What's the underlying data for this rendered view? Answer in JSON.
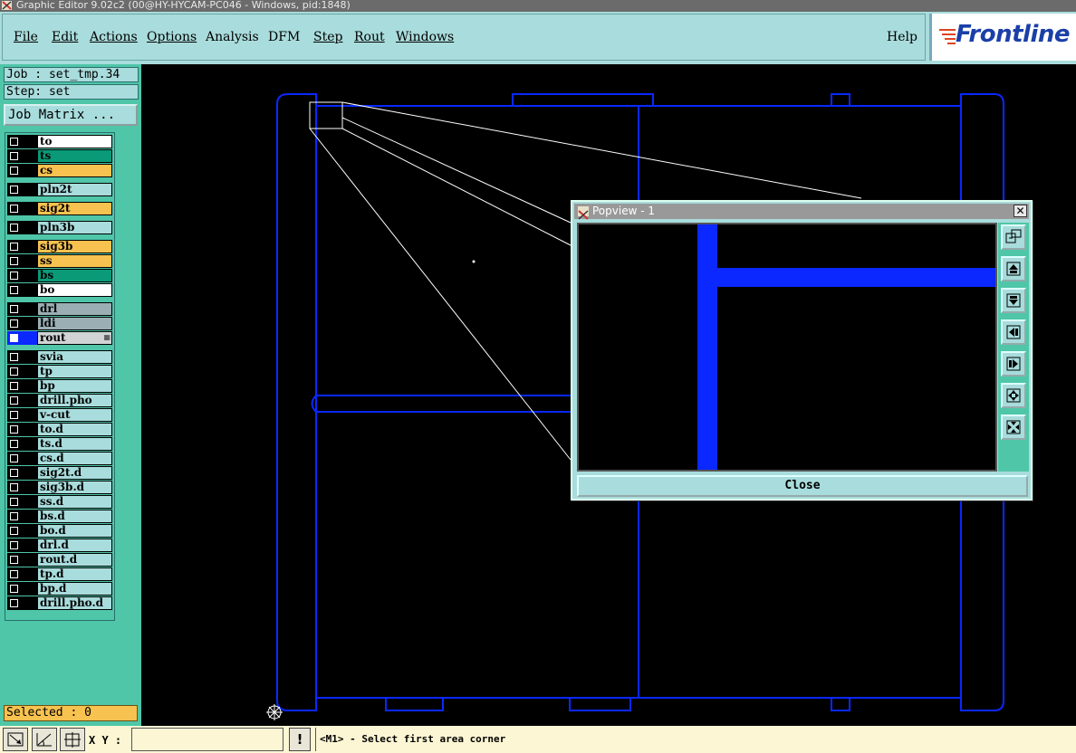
{
  "window": {
    "title": "Graphic Editor 9.02c2 (00@HY-HYCAM-PC046 - Windows, pid:1848)"
  },
  "menu": {
    "items": [
      {
        "label": "File"
      },
      {
        "label": "Edit"
      },
      {
        "label": "Actions"
      },
      {
        "label": "Options"
      },
      {
        "label": "Analysis"
      },
      {
        "label": "DFM"
      },
      {
        "label": "Step"
      },
      {
        "label": "Rout"
      },
      {
        "label": "Windows"
      }
    ],
    "help": "Help",
    "logo": "Frontline"
  },
  "job": {
    "job_label": "Job : set_tmp.34",
    "step_label": "Step: set",
    "job_matrix_button": "Job Matrix ..."
  },
  "layers": [
    {
      "name": "to",
      "color": "#ffffff",
      "active": false
    },
    {
      "name": "ts",
      "color": "#0a9a78",
      "active": false
    },
    {
      "name": "cs",
      "color": "#f7c24f",
      "active": false
    },
    {
      "name": "pln2t",
      "color": "#a9dcdc",
      "active": false
    },
    {
      "name": "sig2t",
      "color": "#f7c24f",
      "active": false
    },
    {
      "name": "pln3b",
      "color": "#a9dcdc",
      "active": false
    },
    {
      "name": "sig3b",
      "color": "#f7c24f",
      "active": false
    },
    {
      "name": "ss",
      "color": "#f7c24f",
      "active": false
    },
    {
      "name": "bs",
      "color": "#0a9a78",
      "active": false
    },
    {
      "name": "bo",
      "color": "#ffffff",
      "active": false
    },
    {
      "name": "drl",
      "color": "#9aaeb4",
      "active": false
    },
    {
      "name": "ldi",
      "color": "#9aaeb4",
      "active": false
    },
    {
      "name": "rout",
      "color": "#d0d4d4",
      "active": true
    },
    {
      "name": "svia",
      "color": "#a9dcdc",
      "active": false
    },
    {
      "name": "tp",
      "color": "#a9dcdc",
      "active": false
    },
    {
      "name": "bp",
      "color": "#a9dcdc",
      "active": false
    },
    {
      "name": "drill.pho",
      "color": "#a9dcdc",
      "active": false
    },
    {
      "name": "v-cut",
      "color": "#a9dcdc",
      "active": false
    },
    {
      "name": "to.d",
      "color": "#a9dcdc",
      "active": false
    },
    {
      "name": "ts.d",
      "color": "#a9dcdc",
      "active": false
    },
    {
      "name": "cs.d",
      "color": "#a9dcdc",
      "active": false
    },
    {
      "name": "sig2t.d",
      "color": "#a9dcdc",
      "active": false
    },
    {
      "name": "sig3b.d",
      "color": "#a9dcdc",
      "active": false
    },
    {
      "name": "ss.d",
      "color": "#a9dcdc",
      "active": false
    },
    {
      "name": "bs.d",
      "color": "#a9dcdc",
      "active": false
    },
    {
      "name": "bo.d",
      "color": "#a9dcdc",
      "active": false
    },
    {
      "name": "drl.d",
      "color": "#a9dcdc",
      "active": false
    },
    {
      "name": "rout.d",
      "color": "#a9dcdc",
      "active": false
    },
    {
      "name": "tp.d",
      "color": "#a9dcdc",
      "active": false
    },
    {
      "name": "bp.d",
      "color": "#a9dcdc",
      "active": false
    },
    {
      "name": "drill.pho.d",
      "color": "#a9dcdc",
      "active": false
    }
  ],
  "selected_label": "Selected : 0",
  "bottom": {
    "xy_label": "X Y :",
    "xy_value": "",
    "alert_button": "!",
    "status_message": "<M1> - Select first area corner"
  },
  "popview": {
    "title": "Popview - 1",
    "close_button": "Close",
    "close_x": "✕"
  },
  "colors": {
    "rout_layer": "#0a28ff",
    "panel_bg": "#4fc6a8",
    "menu_bg": "#a9dcdc"
  }
}
